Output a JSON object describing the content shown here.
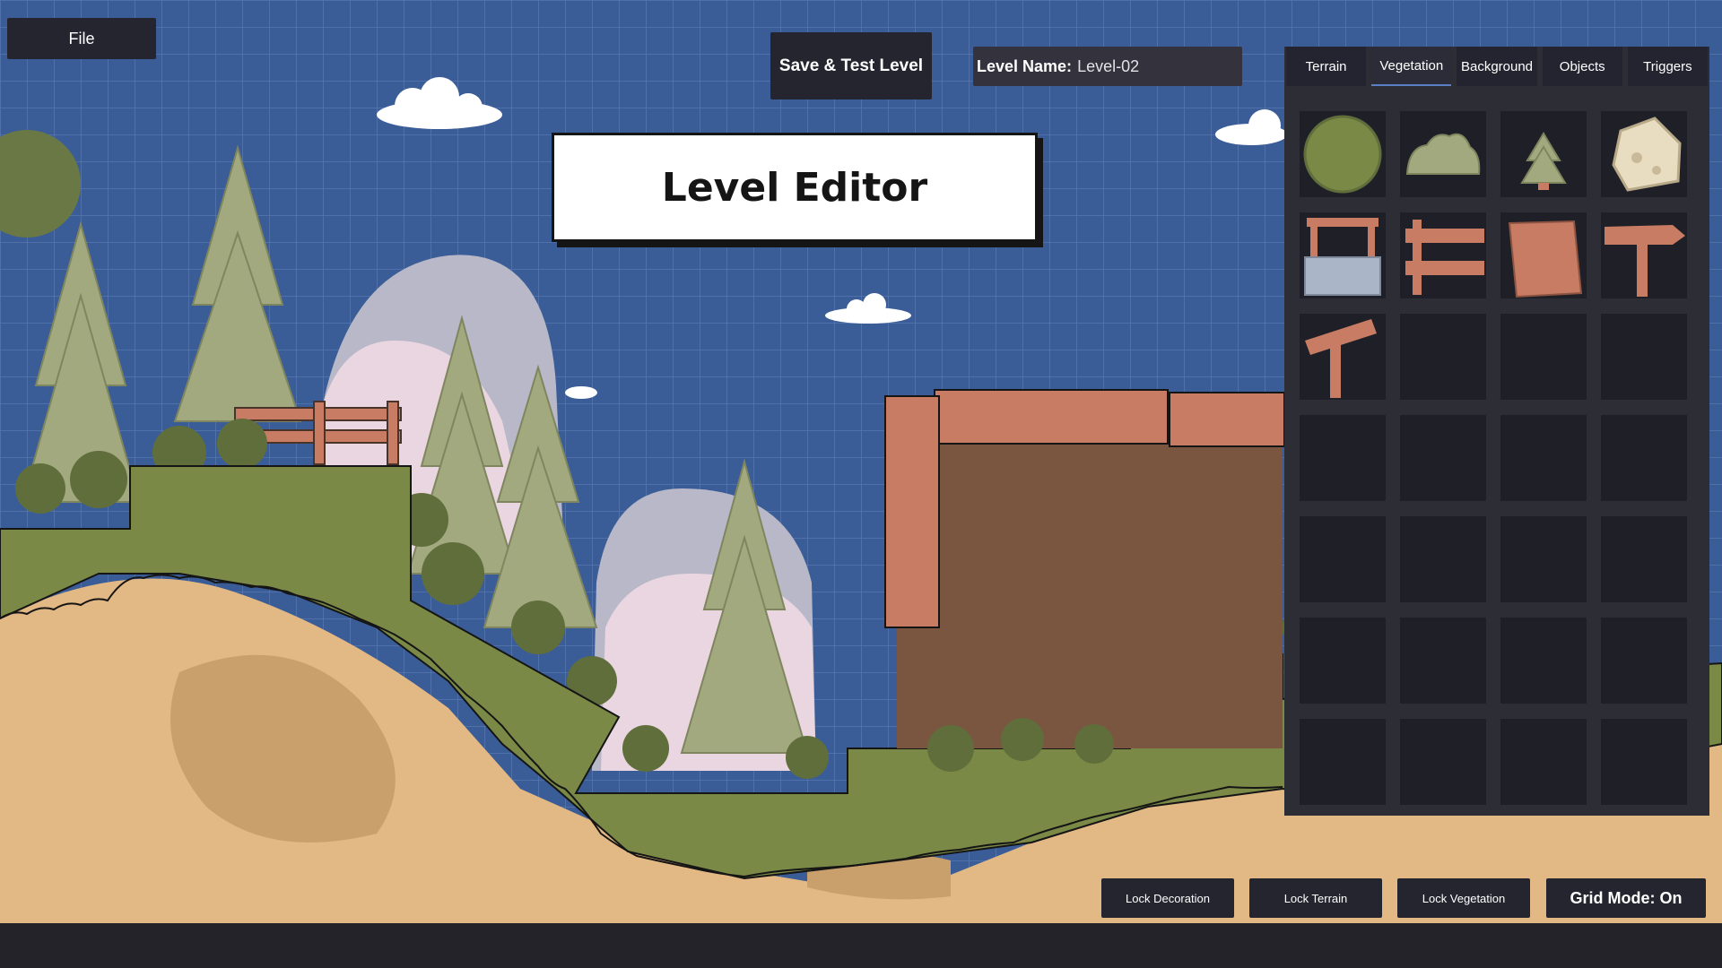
{
  "menu": {
    "file_label": "File"
  },
  "toolbar": {
    "save_test_label": "Save & Test Level",
    "level_name_label": "Level Name:",
    "level_name_value": "Level-02"
  },
  "title_card": {
    "text": "Level Editor"
  },
  "palette": {
    "tabs": [
      {
        "label": "Terrain"
      },
      {
        "label": "Vegetation"
      },
      {
        "label": "Background"
      },
      {
        "label": "Objects"
      },
      {
        "label": "Triggers"
      }
    ],
    "active_tab": "Vegetation",
    "items": [
      {
        "icon": "round-bush-icon"
      },
      {
        "icon": "shrub-icon"
      },
      {
        "icon": "pine-tree-icon"
      },
      {
        "icon": "boulder-icon"
      },
      {
        "icon": "stone-well-icon"
      },
      {
        "icon": "wooden-fence-icon"
      },
      {
        "icon": "wooden-sign-board-icon"
      },
      {
        "icon": "arrow-signpost-icon"
      },
      {
        "icon": "tilted-signpost-icon"
      }
    ],
    "empty_slots": 19
  },
  "bottom_controls": {
    "lock_decoration": "Lock Decoration",
    "lock_terrain": "Lock Terrain",
    "lock_vegetation": "Lock Vegetation",
    "grid_mode": "Grid Mode: On"
  },
  "colors": {
    "sky": "#3b5d97",
    "grid_line": "#5777b0",
    "grass": "#7a8a46",
    "dirt": "#e2b884",
    "dirt_shadow": "#c99f6c",
    "wood": "#c87c64",
    "wood_dark_bg": "#7a5641",
    "pine": "#a3a97e",
    "bush_dark": "#5f6e3b",
    "ui_panel": "#2d2d35",
    "ui_button": "#252530"
  }
}
